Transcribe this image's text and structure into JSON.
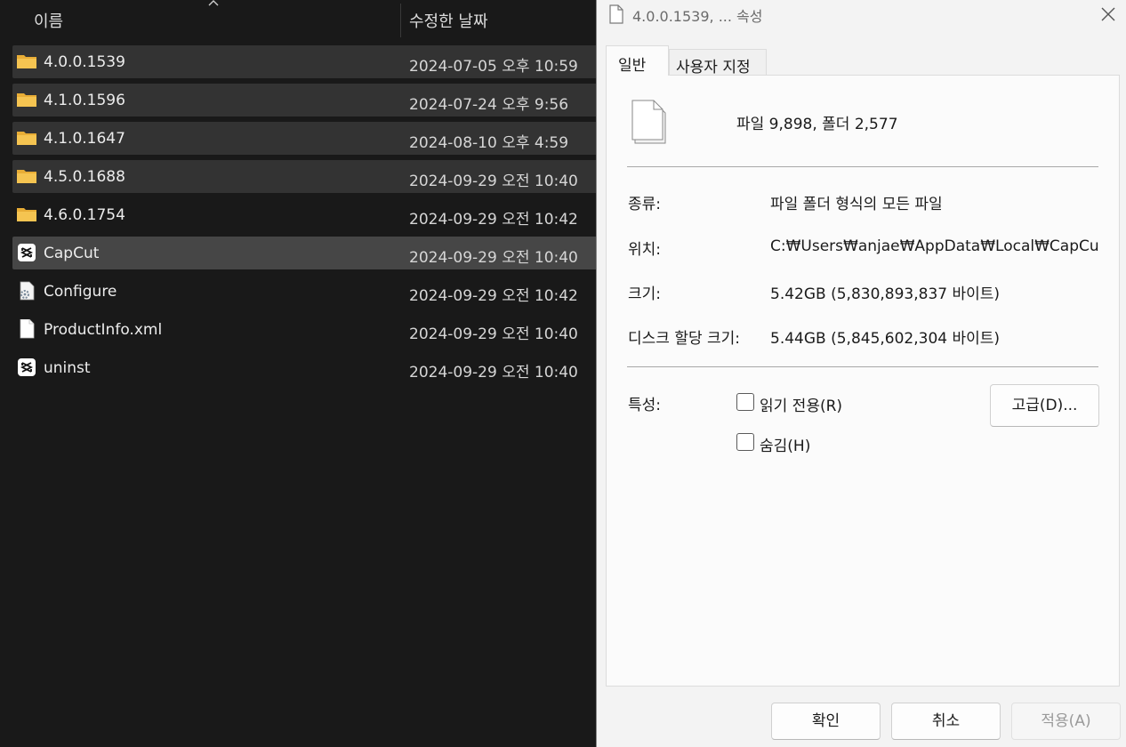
{
  "explorer": {
    "columns": {
      "name": "이름",
      "date": "수정한 날짜"
    },
    "files": [
      {
        "name": "4.0.0.1539",
        "date": "2024-07-05 오후 10:59",
        "icon": "folder-icon",
        "state": "selected"
      },
      {
        "name": "4.1.0.1596",
        "date": "2024-07-24 오후 9:56",
        "icon": "folder-icon",
        "state": "selected"
      },
      {
        "name": "4.1.0.1647",
        "date": "2024-08-10 오후 4:59",
        "icon": "folder-icon",
        "state": "selected"
      },
      {
        "name": "4.5.0.1688",
        "date": "2024-09-29 오전 10:40",
        "icon": "folder-icon",
        "state": "selected"
      },
      {
        "name": "4.6.0.1754",
        "date": "2024-09-29 오전 10:42",
        "icon": "folder-icon",
        "state": "normal"
      },
      {
        "name": "CapCut",
        "date": "2024-09-29 오전 10:40",
        "icon": "capcut-app-icon",
        "state": "hover"
      },
      {
        "name": "Configure",
        "date": "2024-09-29 오전 10:42",
        "icon": "config-file-icon",
        "state": "normal"
      },
      {
        "name": "ProductInfo.xml",
        "date": "2024-09-29 오전 10:40",
        "icon": "file-icon",
        "state": "normal"
      },
      {
        "name": "uninst",
        "date": "2024-09-29 오전 10:40",
        "icon": "capcut-app-icon",
        "state": "normal"
      }
    ]
  },
  "dialog": {
    "title": "4.0.0.1539, ... 속성",
    "tabs": {
      "general": "일반",
      "custom": "사용자 지정"
    },
    "summary": "파일 9,898, 폴더 2,577",
    "props": {
      "type_label": "종류:",
      "type_value": "파일 폴더 형식의 모든 파일",
      "location_label": "위치:",
      "location_value": "C:₩Users₩anjae₩AppData₩Local₩CapCut₩A",
      "size_label": "크기:",
      "size_value": "5.42GB (5,830,893,837 바이트)",
      "disk_label": "디스크 할당 크기:",
      "disk_value": "5.44GB (5,845,602,304 바이트)"
    },
    "attributes": {
      "label": "특성:",
      "readonly": "읽기 전용(R)",
      "hidden": "숨김(H)",
      "advanced": "고급(D)..."
    },
    "buttons": {
      "ok": "확인",
      "cancel": "취소",
      "apply": "적용(A)"
    }
  },
  "colors": {
    "folder": "#f5c451",
    "explorer_bg": "#191919",
    "dialog_bg": "#f3f3f3"
  }
}
